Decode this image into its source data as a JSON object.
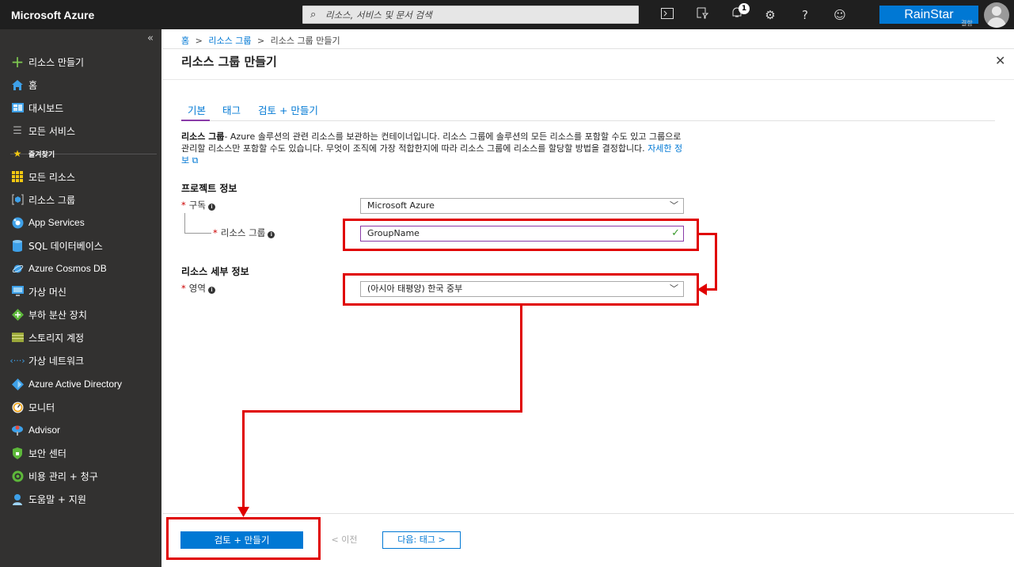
{
  "topbar": {
    "brand": "Microsoft Azure",
    "search_placeholder": "리소스, 서비스 및 문서 검색",
    "notification_count": "1",
    "user_name": "RainStar",
    "user_sub": "결함"
  },
  "sidebar": {
    "collapse_label": "«",
    "create": "리소스 만들기",
    "home": "홈",
    "dashboard": "대시보드",
    "all_services": "모든 서비스",
    "favorites": "즐겨찾기",
    "items": [
      {
        "label": "모든 리소스",
        "icon": "grid-icon"
      },
      {
        "label": "리소스 그룹",
        "icon": "resource-group-icon"
      },
      {
        "label": "App Services",
        "icon": "app-services-icon"
      },
      {
        "label": "SQL 데이터베이스",
        "icon": "sql-database-icon"
      },
      {
        "label": "Azure Cosmos DB",
        "icon": "cosmos-db-icon"
      },
      {
        "label": "가상 머신",
        "icon": "virtual-machine-icon"
      },
      {
        "label": "부하 분산 장치",
        "icon": "load-balancer-icon"
      },
      {
        "label": "스토리지 계정",
        "icon": "storage-account-icon"
      },
      {
        "label": "가상 네트워크",
        "icon": "virtual-network-icon"
      },
      {
        "label": "Azure Active Directory",
        "icon": "active-directory-icon"
      },
      {
        "label": "모니터",
        "icon": "monitor-icon"
      },
      {
        "label": "Advisor",
        "icon": "advisor-icon"
      },
      {
        "label": "보안 센터",
        "icon": "security-center-icon"
      },
      {
        "label": "비용 관리 + 청구",
        "icon": "cost-management-icon"
      },
      {
        "label": "도움말 + 지원",
        "icon": "help-support-icon"
      }
    ]
  },
  "breadcrumb": {
    "home": "홈",
    "groups": "리소스 그룹",
    "current": "리소스 그룹 만들기",
    "sep": ">"
  },
  "page": {
    "title": "리소스 그룹 만들기",
    "tabs": [
      "기본",
      "태그",
      "검토 + 만들기"
    ],
    "desc_bold": "리소스 그룹",
    "desc_text": "- Azure 솔루션의 관련 리소스를 보관하는 컨테이너입니다. 리소스 그룹에 솔루션의 모든 리소스를 포함할 수도 있고 그룹으로 관리할 리소스만 포함할 수도 있습니다. 무엇이 조직에 가장 적합한지에 따라 리소스 그룹에 리소스를 할당할 방법을 결정합니다. ",
    "desc_link": "자세한 정보"
  },
  "project": {
    "heading": "프로젝트 정보",
    "subscription_label": "구독",
    "subscription_value": "Microsoft Azure",
    "group_label": "리소스 그룹",
    "group_value": "GroupName"
  },
  "details": {
    "heading": "리소스 세부 정보",
    "region_label": "영역",
    "region_value": "(아시아 태평양) 한국 중부"
  },
  "footer": {
    "create": "검토 + 만들기",
    "prev": "< 이전",
    "next": "다음: 태그 >"
  },
  "colors": {
    "accent": "#0078d4",
    "annotation": "#e00000",
    "sidebar": "#323130",
    "topbar": "#1f1f1f"
  }
}
